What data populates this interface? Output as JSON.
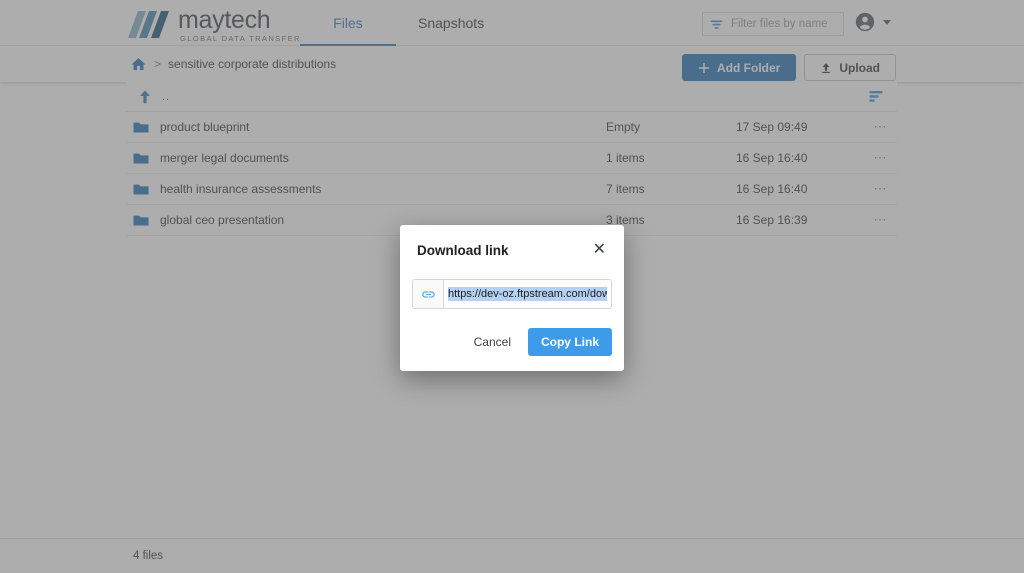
{
  "brand": {
    "name": "maytech",
    "tagline": "GLOBAL DATA TRANSFER",
    "logo_icon": "maytech-logo-icon",
    "colors": {
      "primary_blue": "#2e7ab8",
      "tab_blue": "#3780c0",
      "folder_blue": "#2e7ab8",
      "copy_button_blue": "#3d9be9",
      "selection_highlight": "#b4d0f5"
    }
  },
  "header": {
    "tabs": [
      {
        "label": "Files",
        "active": true
      },
      {
        "label": "Snapshots",
        "active": false
      }
    ],
    "filter": {
      "icon": "filter-icon",
      "placeholder": "Filter files by name",
      "value": ""
    },
    "account": {
      "avatar_icon": "account-circle-icon",
      "caret_icon": "chevron-down-icon"
    }
  },
  "breadcrumb": {
    "home_icon": "home-icon",
    "separator": ">",
    "current": "sensitive corporate distributions"
  },
  "actions": {
    "add_folder": {
      "label": "Add Folder",
      "icon": "plus-icon"
    },
    "upload": {
      "label": "Upload",
      "icon": "upload-icon"
    }
  },
  "file_list": {
    "toolbar": {
      "up_icon": "arrow-up-icon",
      "up_label": "..",
      "sort_icon": "sort-icon"
    },
    "rows": [
      {
        "icon": "folder-icon",
        "name": "product blueprint",
        "size": "Empty",
        "date": "17 Sep 09:49",
        "menu": "⋯"
      },
      {
        "icon": "folder-icon",
        "name": "merger legal documents",
        "size": "1 items",
        "date": "16 Sep 16:40",
        "menu": "⋯"
      },
      {
        "icon": "folder-icon",
        "name": "health insurance assessments",
        "size": "7 items",
        "date": "16 Sep 16:40",
        "menu": "⋯"
      },
      {
        "icon": "folder-icon",
        "name": "global ceo presentation",
        "size": "3 items",
        "date": "16 Sep 16:39",
        "menu": "⋯"
      }
    ]
  },
  "footer": {
    "count_label": "4 files"
  },
  "modal": {
    "title": "Download link",
    "close_icon": "close-icon",
    "link": {
      "icon": "link-icon",
      "value": "https://dev-oz.ftpstream.com/downloa"
    },
    "cancel_label": "Cancel",
    "copy_label": "Copy Link"
  }
}
